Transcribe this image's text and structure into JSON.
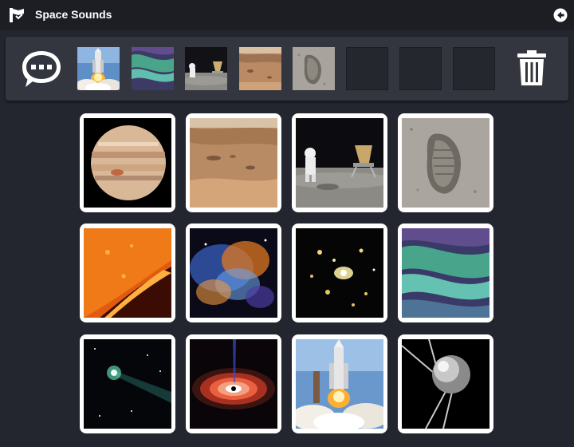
{
  "app": {
    "title": "Space Sounds",
    "icons": {
      "logo": "flag-logo-icon",
      "back": "back-arrow-icon",
      "speak": "speech-bubble-icon",
      "clear": "trash-icon"
    },
    "colors": {
      "background": "#23262e",
      "topbar": "#1c1e24",
      "strip": "#33363e",
      "tile_border": "#ffffff"
    }
  },
  "sentence_strip": {
    "items": [
      "space-shuttle-launch",
      "aurora",
      "astronaut-on-moon",
      "mars-surface",
      "footprint-on-moon"
    ],
    "empty_slots": 3
  },
  "board": {
    "rows": 3,
    "columns": 4,
    "tiles": [
      "jupiter",
      "mars-surface",
      "astronaut-on-moon",
      "footprint-on-moon",
      "sun-surface",
      "nebula",
      "galaxy-cluster",
      "aurora",
      "comet",
      "black-hole",
      "space-shuttle-launch",
      "sputnik"
    ]
  }
}
